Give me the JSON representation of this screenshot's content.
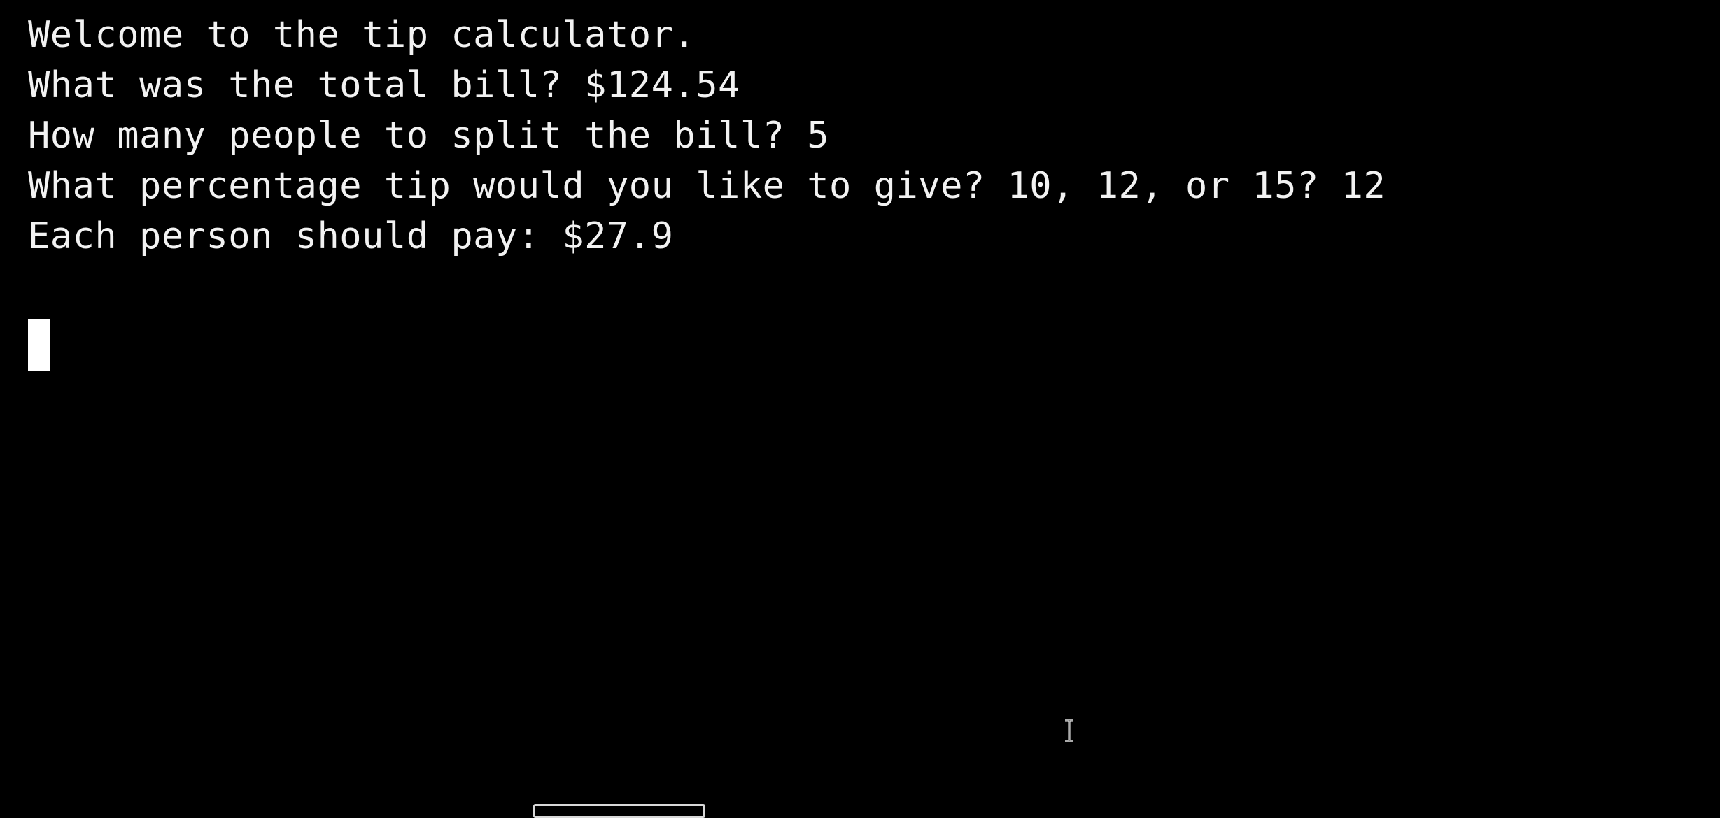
{
  "terminal": {
    "lines": [
      "Welcome to the tip calculator.",
      "What was the total bill? $124.54",
      "How many people to split the bill? 5",
      "What percentage tip would you like to give? 10, 12, or 15? 12",
      "Each person should pay: $27.9"
    ],
    "cursor_icon": "block-cursor",
    "pointer_icon": "ibeam-cursor-icon"
  },
  "colors": {
    "background": "#000000",
    "text": "#f2f2f2",
    "cursor": "#ffffff"
  }
}
